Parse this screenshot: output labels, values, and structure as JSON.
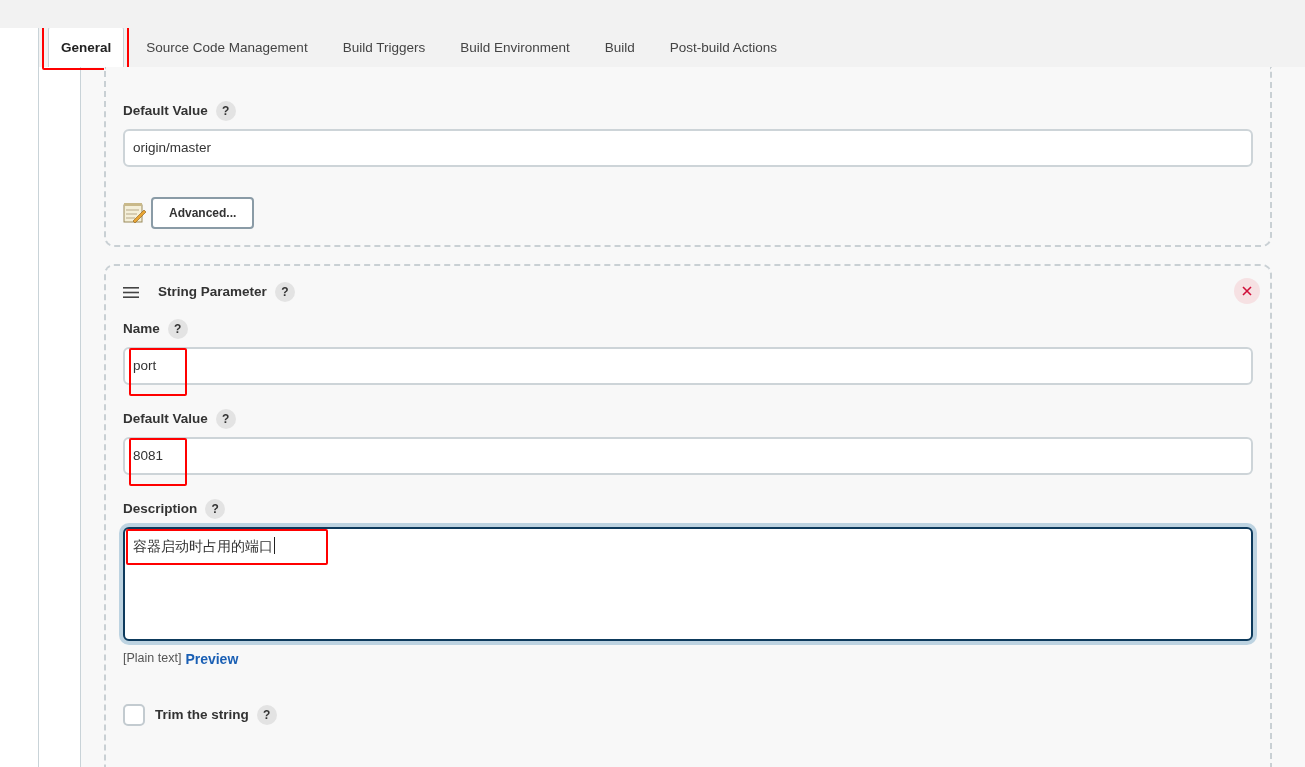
{
  "tabs": [
    {
      "label": "General",
      "selected": true,
      "annotated": true
    },
    {
      "label": "Source Code Management",
      "selected": false,
      "annotated": false
    },
    {
      "label": "Build Triggers",
      "selected": false,
      "annotated": false
    },
    {
      "label": "Build Environment",
      "selected": false,
      "annotated": false
    },
    {
      "label": "Build",
      "selected": false,
      "annotated": false
    },
    {
      "label": "Post-build Actions",
      "selected": false,
      "annotated": false
    }
  ],
  "upper_parameter": {
    "fields": [
      {
        "kind": "input",
        "label": "Default Value",
        "help": "?",
        "value": "origin/master"
      }
    ],
    "advanced_button": "Advanced..."
  },
  "string_parameter": {
    "title": "String Parameter",
    "help": "?",
    "fields": [
      {
        "kind": "input",
        "label": "Name",
        "help": "?",
        "value": "port",
        "annotated": true,
        "focused": false
      },
      {
        "kind": "input",
        "label": "Default Value",
        "help": "?",
        "value": "8081",
        "annotated": true,
        "focused": false
      },
      {
        "kind": "textarea",
        "label": "Description",
        "help": "?",
        "value": "容器启动时占用的端口",
        "annotated": true,
        "focused": true,
        "format_note": "[Plain text]",
        "preview_link": "Preview"
      }
    ],
    "trim": {
      "label": "Trim the string",
      "help": "?",
      "checked": false
    }
  }
}
